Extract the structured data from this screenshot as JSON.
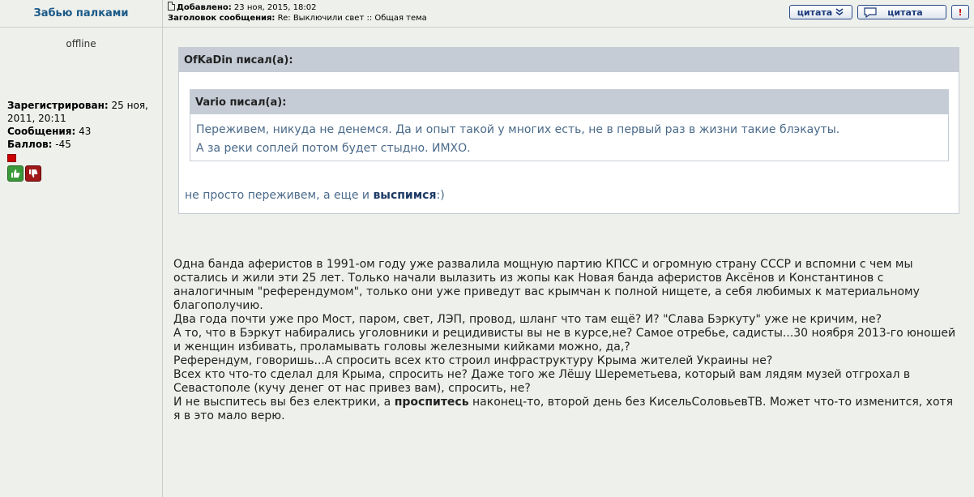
{
  "author": {
    "username": "Забью палками",
    "status": "offline",
    "registered_label": "Зарегистрирован:",
    "registered_value": "25 ноя, 2011, 20:11",
    "messages_label": "Сообщения:",
    "messages_value": "43",
    "score_label": "Баллов:",
    "score_value": "-45"
  },
  "header": {
    "added_label": "Добавлено:",
    "added_value": "23 ноя, 2015, 18:02",
    "subject_label": "Заголовок сообщения:",
    "subject_value": "Re: Выключили свет :: Общая тема",
    "quote_btn_1": "цитата",
    "quote_btn_2": "цитата",
    "warn_btn": "!"
  },
  "quote_outer": {
    "header": "OfKaDin писал(а):",
    "text_pre": "не просто переживем, а еще и ",
    "text_bold": "выспимся",
    "text_post": ":)"
  },
  "quote_inner": {
    "header": "Vario писал(а):",
    "line1": "Переживем, никуда не денемся. Да и опыт такой у многих есть, не в первый раз в жизни такие блэкауты.",
    "line2": "А за реки соплей потом будет стыдно. ИМХО."
  },
  "post": {
    "p1": "Одна банда аферистов в 1991-ом году уже развалила мощную партию КПСС и огромную страну СССР и вспомни с чем мы остались и жили эти 25 лет. Только начали вылазить из жопы как Новая банда аферистов Аксёнов и Константинов с аналогичным \"референдумом\", только они уже приведут вас крымчан к полной нищете, а себя любимых к материальному благополучию.",
    "p2": "Два года почти уже про Мост, паром, свет, ЛЭП, провод, шланг что там ещё? И? \"Слава Бэркуту\" уже не кричим, не?",
    "p3": "А то, что в Бэркут набирались уголовники и рецидивисты вы не в курсе,не? Самое отребье, садисты...30 ноября 2013-го юношей и женщин избивать, проламывать головы железными кийками можно, да,?",
    "p4": "Референдум, говоришь...А спросить всех кто строил инфраструктуру Крыма жителей Украины не?",
    "p5": "Всех кто что-то сделал для Крыма, спросить не? Даже того же Лёшу Шереметьева, который вам лядям музей отгрохал в Севастополе (кучу денег от нас привез вам), спросить, не?",
    "p6_pre": "И не выспитесь вы без електрики, а ",
    "p6_bold": "проспитесь",
    "p6_post": " наконец-то, второй день без КисельСоловьевТВ. Может что-то изменится, хотя я в это мало верю."
  }
}
